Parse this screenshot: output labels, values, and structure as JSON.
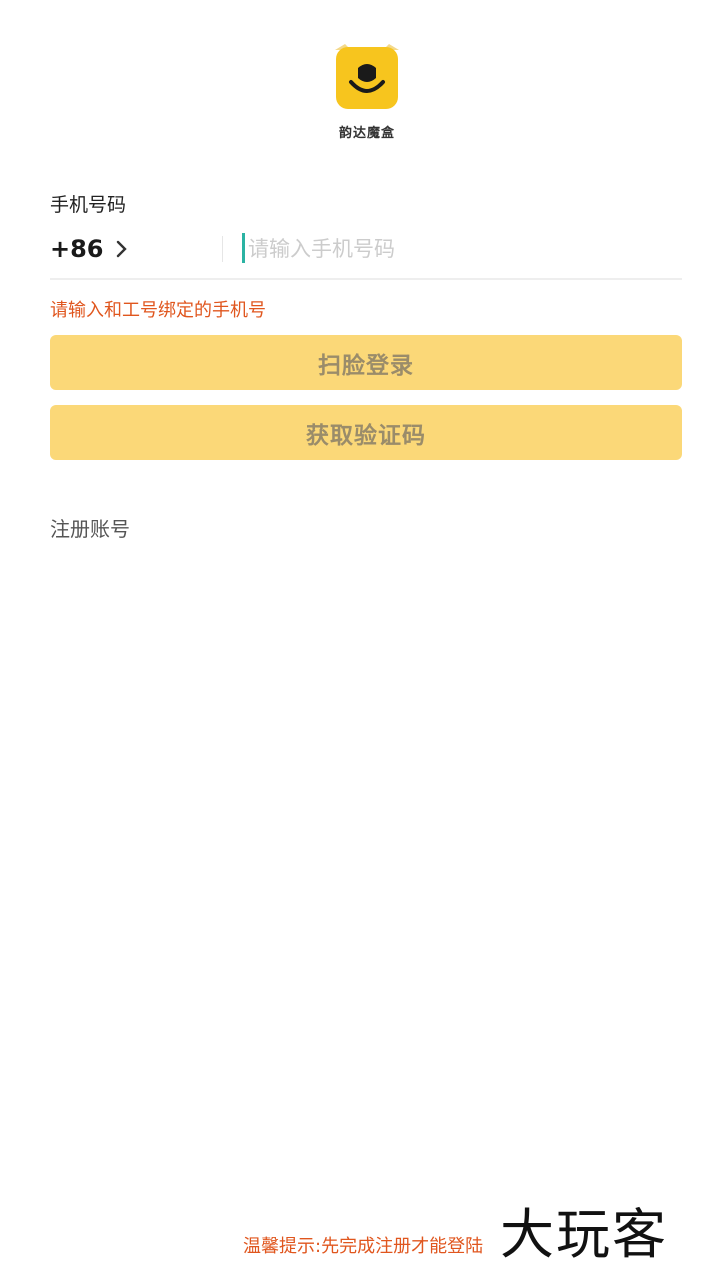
{
  "app": {
    "logo_label": "韵达魔盒",
    "logo_color": "#F7C51E"
  },
  "login": {
    "phone_label": "手机号码",
    "country_code": "+86",
    "phone_placeholder": "请输入手机号码",
    "phone_value": "",
    "hint": "请输入和工号绑定的手机号",
    "face_login_label": "扫脸登录",
    "get_code_label": "获取验证码",
    "register_label": "注册账号"
  },
  "footer": {
    "tip": "温馨提示:先完成注册才能登陆",
    "watermark": "大玩客"
  },
  "colors": {
    "accent": "#FBD878",
    "warning": "#E0561E",
    "caret": "#2BB3A3"
  },
  "icons": {
    "logo": "yunda-logo-icon",
    "chevron": "chevron-right-icon"
  }
}
